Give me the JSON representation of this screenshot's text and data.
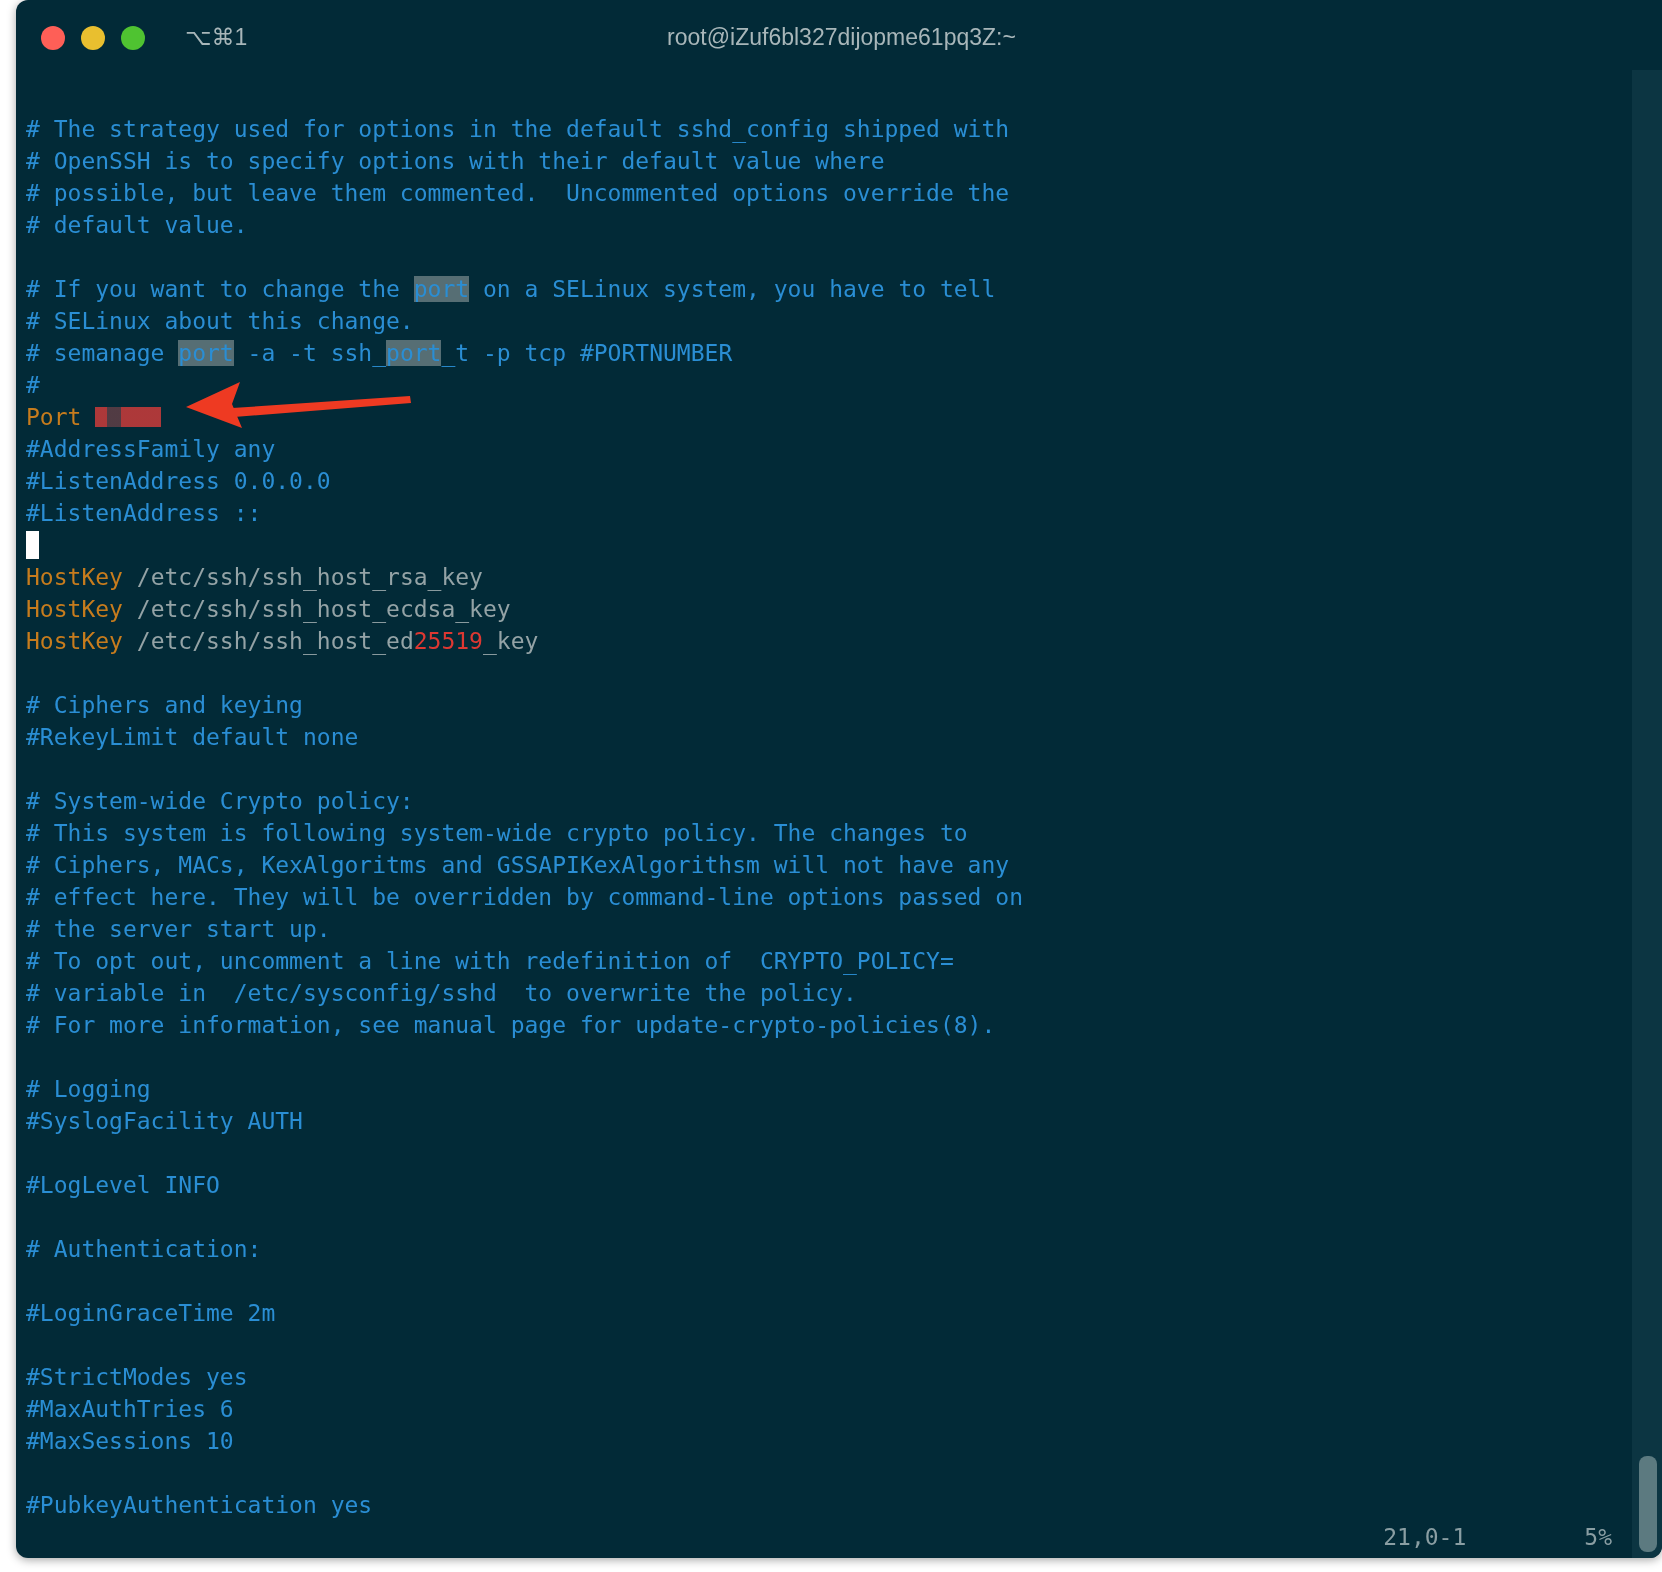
{
  "window": {
    "title": "root@iZuf6bl327dijopme61pq3Z:~",
    "shortcut": "⌥⌘1"
  },
  "lines": [
    {
      "segments": [
        {
          "kind": "comment",
          "text": "# The strategy used for options in the default sshd_config shipped with"
        }
      ]
    },
    {
      "segments": [
        {
          "kind": "comment",
          "text": "# OpenSSH is to specify options with their default value where"
        }
      ]
    },
    {
      "segments": [
        {
          "kind": "comment",
          "text": "# possible, but leave them commented.  Uncommented options override the"
        }
      ]
    },
    {
      "segments": [
        {
          "kind": "comment",
          "text": "# default value."
        }
      ]
    },
    {
      "kind": "blank"
    },
    {
      "segments": [
        {
          "kind": "comment",
          "text": "# If you want to change the "
        },
        {
          "kind": "match",
          "text": "port"
        },
        {
          "kind": "comment",
          "text": " on a SELinux system, you have to tell"
        }
      ]
    },
    {
      "segments": [
        {
          "kind": "comment",
          "text": "# SELinux about this change."
        }
      ]
    },
    {
      "segments": [
        {
          "kind": "comment",
          "text": "# semanage "
        },
        {
          "kind": "match",
          "text": "port"
        },
        {
          "kind": "comment",
          "text": " -a -t ssh_"
        },
        {
          "kind": "match",
          "text": "port"
        },
        {
          "kind": "comment",
          "text": "_t -p tcp #PORTNUMBER"
        }
      ]
    },
    {
      "segments": [
        {
          "kind": "comment",
          "text": "#"
        }
      ]
    },
    {
      "segments": [
        {
          "kind": "keyword",
          "text": "Port "
        },
        {
          "kind": "redacted"
        }
      ]
    },
    {
      "segments": [
        {
          "kind": "comment",
          "text": "#AddressFamily any"
        }
      ]
    },
    {
      "segments": [
        {
          "kind": "comment",
          "text": "#ListenAddress 0.0.0.0"
        }
      ]
    },
    {
      "segments": [
        {
          "kind": "comment",
          "text": "#ListenAddress ::"
        }
      ]
    },
    {
      "kind": "cursor"
    },
    {
      "segments": [
        {
          "kind": "keyword",
          "text": "HostKey"
        },
        {
          "kind": "plain",
          "text": " /etc/ssh/ssh_host_rsa_key"
        }
      ]
    },
    {
      "segments": [
        {
          "kind": "keyword",
          "text": "HostKey"
        },
        {
          "kind": "plain",
          "text": " /etc/ssh/ssh_host_ecdsa_key"
        }
      ]
    },
    {
      "segments": [
        {
          "kind": "keyword",
          "text": "HostKey"
        },
        {
          "kind": "plain",
          "text": " /etc/ssh/ssh_host_ed"
        },
        {
          "kind": "number",
          "text": "25519"
        },
        {
          "kind": "plain",
          "text": "_key"
        }
      ]
    },
    {
      "kind": "blank"
    },
    {
      "segments": [
        {
          "kind": "comment",
          "text": "# Ciphers and keying"
        }
      ]
    },
    {
      "segments": [
        {
          "kind": "comment",
          "text": "#RekeyLimit default none"
        }
      ]
    },
    {
      "kind": "blank"
    },
    {
      "segments": [
        {
          "kind": "comment",
          "text": "# System-wide Crypto policy:"
        }
      ]
    },
    {
      "segments": [
        {
          "kind": "comment",
          "text": "# This system is following system-wide crypto policy. The changes to"
        }
      ]
    },
    {
      "segments": [
        {
          "kind": "comment",
          "text": "# Ciphers, MACs, KexAlgoritms and GSSAPIKexAlgorithsm will not have any"
        }
      ]
    },
    {
      "segments": [
        {
          "kind": "comment",
          "text": "# effect here. They will be overridden by command-line options passed on"
        }
      ]
    },
    {
      "segments": [
        {
          "kind": "comment",
          "text": "# the server start up."
        }
      ]
    },
    {
      "segments": [
        {
          "kind": "comment",
          "text": "# To opt out, uncomment a line with redefinition of  CRYPTO_POLICY="
        }
      ]
    },
    {
      "segments": [
        {
          "kind": "comment",
          "text": "# variable in  /etc/sysconfig/sshd  to overwrite the policy."
        }
      ]
    },
    {
      "segments": [
        {
          "kind": "comment",
          "text": "# For more information, see manual page for update-crypto-policies(8)."
        }
      ]
    },
    {
      "kind": "blank"
    },
    {
      "segments": [
        {
          "kind": "comment",
          "text": "# Logging"
        }
      ]
    },
    {
      "segments": [
        {
          "kind": "comment",
          "text": "#SyslogFacility AUTH"
        }
      ]
    },
    {
      "kind": "blank"
    },
    {
      "segments": [
        {
          "kind": "comment",
          "text": "#LogLevel INFO"
        }
      ]
    },
    {
      "kind": "blank"
    },
    {
      "segments": [
        {
          "kind": "comment",
          "text": "# Authentication:"
        }
      ]
    },
    {
      "kind": "blank"
    },
    {
      "segments": [
        {
          "kind": "comment",
          "text": "#LoginGraceTime 2m"
        }
      ]
    },
    {
      "kind": "blank"
    },
    {
      "segments": [
        {
          "kind": "comment",
          "text": "#StrictModes yes"
        }
      ]
    },
    {
      "segments": [
        {
          "kind": "comment",
          "text": "#MaxAuthTries 6"
        }
      ]
    },
    {
      "segments": [
        {
          "kind": "comment",
          "text": "#MaxSessions 10"
        }
      ]
    },
    {
      "kind": "blank"
    },
    {
      "segments": [
        {
          "kind": "comment",
          "text": "#PubkeyAuthentication yes"
        }
      ]
    }
  ],
  "status": {
    "position": "21,0-1",
    "percent": "5%"
  }
}
